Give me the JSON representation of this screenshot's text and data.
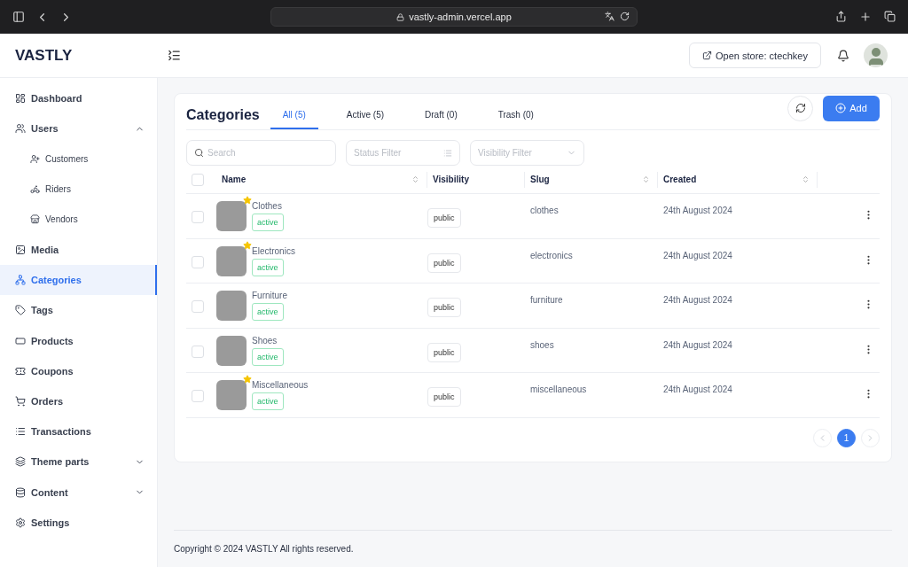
{
  "browser": {
    "url": "vastly-admin.vercel.app"
  },
  "header": {
    "logo": "VASTLY",
    "store_button": "Open store: ctechkey"
  },
  "sidebar": {
    "items": [
      {
        "label": "Dashboard",
        "selected": false
      },
      {
        "label": "Users",
        "selected": false,
        "expanded": true,
        "children": [
          {
            "label": "Customers",
            "selected": false
          },
          {
            "label": "Riders",
            "selected": false
          },
          {
            "label": "Vendors",
            "selected": false
          }
        ]
      },
      {
        "label": "Media",
        "selected": false
      },
      {
        "label": "Categories",
        "selected": true
      },
      {
        "label": "Tags",
        "selected": false
      },
      {
        "label": "Products",
        "selected": false
      },
      {
        "label": "Coupons",
        "selected": false
      },
      {
        "label": "Orders",
        "selected": false
      },
      {
        "label": "Transactions",
        "selected": false
      },
      {
        "label": "Theme parts",
        "selected": false,
        "expanded": false
      },
      {
        "label": "Content",
        "selected": false,
        "expanded": false
      },
      {
        "label": "Settings",
        "selected": false
      }
    ]
  },
  "page": {
    "title": "Categories",
    "add_button": "Add"
  },
  "tabs": [
    {
      "label": "All (5)",
      "selected": true
    },
    {
      "label": "Active (5)",
      "selected": false
    },
    {
      "label": "Draft (0)",
      "selected": false
    },
    {
      "label": "Trash (0)",
      "selected": false
    }
  ],
  "filters": {
    "search_placeholder": "Search",
    "status_placeholder": "Status Filter",
    "visibility_placeholder": "Visibility Filter"
  },
  "table": {
    "all_checked": false,
    "columns": [
      "Name",
      "Visibility",
      "Slug",
      "Created"
    ],
    "rows": [
      {
        "name": "Clothes",
        "status": "active",
        "featured": true,
        "visibility": "public",
        "slug": "clothes",
        "created": "24th August 2024",
        "checked": false
      },
      {
        "name": "Electronics",
        "status": "active",
        "featured": true,
        "visibility": "public",
        "slug": "electronics",
        "created": "24th August 2024",
        "checked": false
      },
      {
        "name": "Furniture",
        "status": "active",
        "featured": false,
        "visibility": "public",
        "slug": "furniture",
        "created": "24th August 2024",
        "checked": false
      },
      {
        "name": "Shoes",
        "status": "active",
        "featured": false,
        "visibility": "public",
        "slug": "shoes",
        "created": "24th August 2024",
        "checked": false
      },
      {
        "name": "Miscellaneous",
        "status": "active",
        "featured": true,
        "visibility": "public",
        "slug": "miscellaneous",
        "created": "24th August 2024",
        "checked": false
      }
    ]
  },
  "pagination": {
    "pages": [
      {
        "label": "1",
        "selected": true
      }
    ]
  },
  "footer": "Copyright © 2024 VASTLY All rights reserved."
}
